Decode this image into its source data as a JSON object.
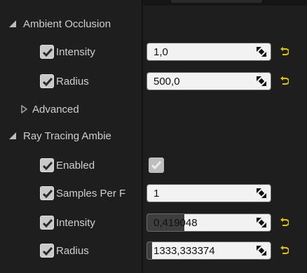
{
  "sections": {
    "ambient_occlusion": {
      "title": "Ambient Occlusion",
      "intensity": {
        "label": "Intensity",
        "value": "1,0",
        "override": true
      },
      "radius": {
        "label": "Radius",
        "value": "500,0",
        "override": true
      },
      "advanced": {
        "label": "Advanced"
      }
    },
    "rt_ambient": {
      "title": "Ray Tracing Ambie",
      "enabled": {
        "label": "Enabled",
        "override": true,
        "value": true
      },
      "samples": {
        "label": "Samples Per F",
        "value": "1",
        "override": true
      },
      "intensity": {
        "label": "Intensity",
        "value": "0,419048",
        "override": true,
        "fill": 0.3
      },
      "radius": {
        "label": "Radius",
        "value": "1333,333374",
        "override": true,
        "fill": 0.02
      }
    }
  },
  "colors": {
    "reset_arrow": "#e8c400",
    "field_bg": "#f2f2f2",
    "checkbox": "#c9c9c9"
  },
  "icons": {
    "spin": "drag-spinner-icon",
    "reset": "reset-to-default-icon",
    "check": "checkmark-icon"
  }
}
